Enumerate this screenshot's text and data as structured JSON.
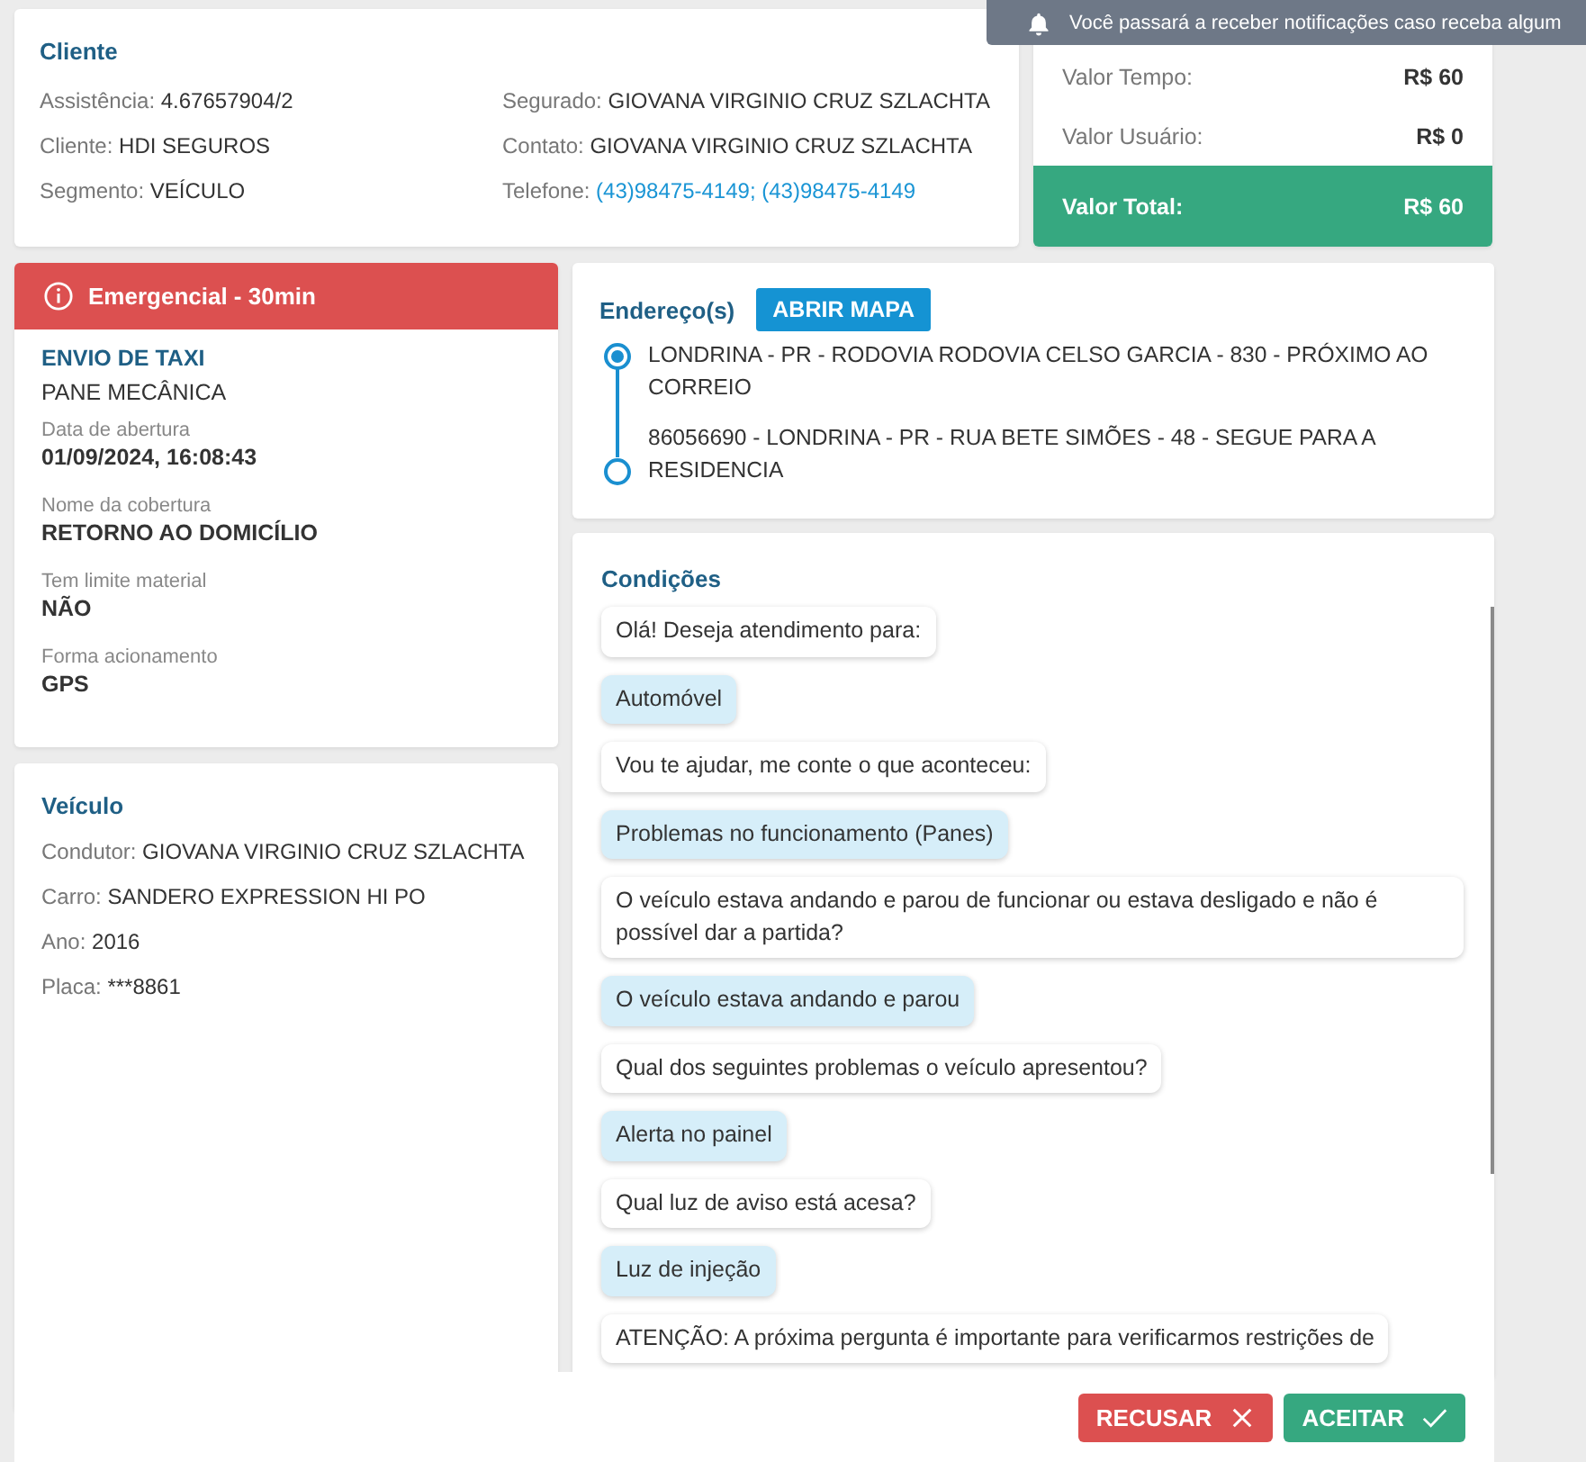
{
  "toast": {
    "text": "Você passará a receber notificações caso receba algum"
  },
  "client": {
    "title": "Cliente",
    "columns": [
      [
        {
          "label": "Assistência:",
          "value": "4.67657904/2",
          "kind": "text"
        },
        {
          "label": "Cliente:",
          "value": "HDI SEGUROS",
          "kind": "text"
        },
        {
          "label": "Segmento:",
          "value": "VEÍCULO",
          "kind": "text"
        }
      ],
      [
        {
          "label": "Segurado:",
          "value": "GIOVANA VIRGINIO CRUZ SZLACHTA",
          "kind": "text"
        },
        {
          "label": "Contato:",
          "value": "GIOVANA VIRGINIO CRUZ SZLACHTA",
          "kind": "text"
        },
        {
          "label": "Telefone:",
          "value": "(43)98475-4149; (43)98475-4149",
          "kind": "link"
        }
      ]
    ]
  },
  "values": [
    {
      "label": "Valor Tempo:",
      "amount": "R$ 60",
      "kind": "row"
    },
    {
      "label": "Valor Usuário:",
      "amount": "R$ 0",
      "kind": "row"
    },
    {
      "label": "Valor Total:",
      "amount": "R$ 60",
      "kind": "total"
    }
  ],
  "service": {
    "alert": "Emergencial - 30min",
    "type": "ENVIO DE TAXI",
    "problem": "PANE MECÂNICA",
    "fields": [
      {
        "label": "Data de abertura",
        "value": "01/09/2024, 16:08:43"
      },
      {
        "label": "Nome da cobertura",
        "value": "RETORNO AO DOMICÍLIO"
      },
      {
        "label": "Tem limite material",
        "value": "NÃO"
      },
      {
        "label": "Forma acionamento",
        "value": "GPS"
      }
    ]
  },
  "vehicle": {
    "title": "Veículo",
    "fields": [
      {
        "label": "Condutor:",
        "value": "GIOVANA VIRGINIO CRUZ SZLACHTA"
      },
      {
        "label": "Carro:",
        "value": "SANDERO EXPRESSION HI PO"
      },
      {
        "label": "Ano:",
        "value": "2016"
      },
      {
        "label": "Placa:",
        "value": "***8861"
      }
    ]
  },
  "addresses": {
    "title": "Endereço(s)",
    "button": "ABRIR MAPA",
    "items": [
      {
        "text": "LONDRINA - PR - RODOVIA RODOVIA CELSO GARCIA - 830 - PRÓXIMO AO CORREIO",
        "kind": "origin"
      },
      {
        "text": "86056690 - LONDRINA - PR - RUA BETE SIMÕES - 48 - SEGUE PARA A RESIDENCIA",
        "kind": "destination"
      }
    ]
  },
  "conditions": {
    "title": "Condições",
    "messages": [
      {
        "text": "Olá! Deseja atendimento para:",
        "kind": "question"
      },
      {
        "text": "Automóvel",
        "kind": "answer"
      },
      {
        "text": "Vou te ajudar, me conte o que aconteceu:",
        "kind": "question"
      },
      {
        "text": "Problemas no funcionamento (Panes)",
        "kind": "answer"
      },
      {
        "text": "O veículo estava andando e parou de funcionar ou estava desligado e não é possível dar a partida?",
        "kind": "question"
      },
      {
        "text": "O veículo estava andando e parou",
        "kind": "answer"
      },
      {
        "text": "Qual dos seguintes problemas o veículo apresentou?",
        "kind": "question"
      },
      {
        "text": "Alerta no painel",
        "kind": "answer"
      },
      {
        "text": "Qual luz de aviso está acesa?",
        "kind": "question"
      },
      {
        "text": "Luz de injeção",
        "kind": "answer"
      },
      {
        "text": "ATENÇÃO: A próxima pergunta é importante para verificarmos restrições de",
        "kind": "question"
      }
    ]
  },
  "actions": [
    {
      "label": "RECUSAR",
      "kind": "reject"
    },
    {
      "label": "ACEITAR",
      "kind": "accept"
    }
  ]
}
